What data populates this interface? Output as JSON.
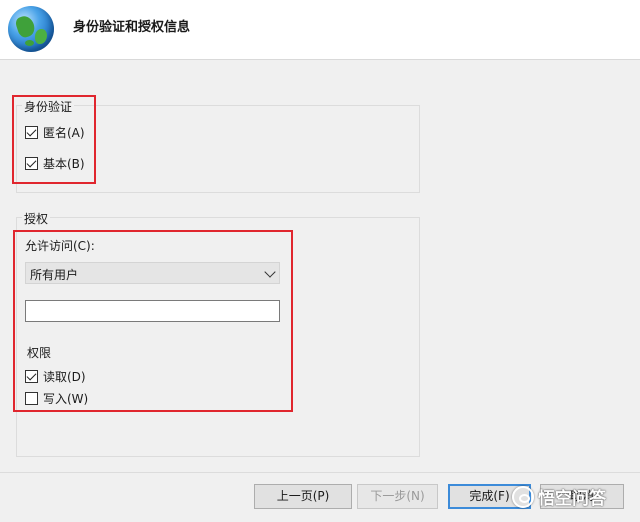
{
  "header": {
    "title": "身份验证和授权信息",
    "icon": "globe-icon"
  },
  "auth_group": {
    "title": "身份验证",
    "anonymous": {
      "label": "匿名(A)",
      "checked": true
    },
    "basic": {
      "label": "基本(B)",
      "checked": true
    }
  },
  "authorization_group": {
    "title": "授权",
    "allow_access_label": "允许访问(C):",
    "allow_access_value": "所有用户",
    "allow_access_input_value": "",
    "permissions_label": "权限",
    "read": {
      "label": "读取(D)",
      "checked": true
    },
    "write": {
      "label": "写入(W)",
      "checked": false
    }
  },
  "buttons": {
    "previous": "上一页(P)",
    "next": "下一步(N)",
    "finish": "完成(F)",
    "cancel": "取消"
  },
  "watermark": {
    "text": "悟空问答"
  },
  "colors": {
    "highlight": "#e0262e",
    "focus": "#3c8bd9"
  }
}
